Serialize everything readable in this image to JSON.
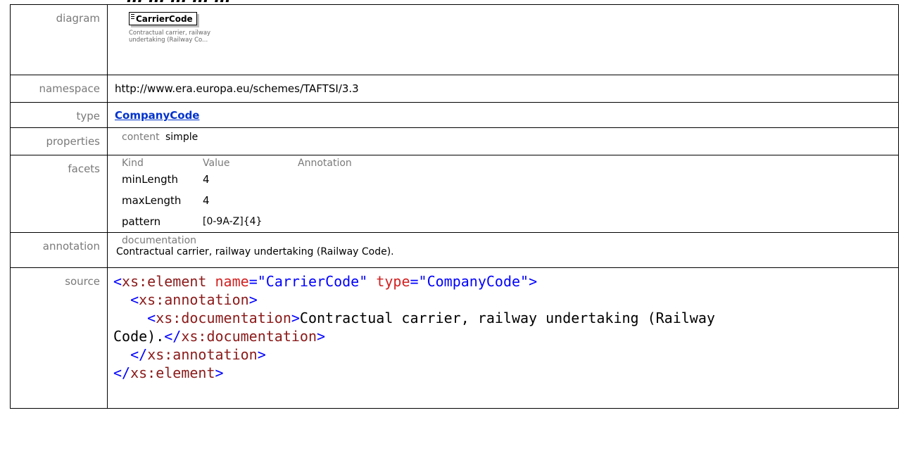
{
  "cut_title": "... ... ... ... ...",
  "rows": {
    "diagram": {
      "label": "diagram",
      "element_name": "CarrierCode",
      "element_desc": "Contractual carrier, railway undertaking (Railway Co..."
    },
    "namespace": {
      "label": "namespace",
      "value": "http://www.era.europa.eu/schemes/TAFTSI/3.3"
    },
    "type": {
      "label": "type",
      "value": "CompanyCode"
    },
    "properties": {
      "label": "properties",
      "key": "content",
      "value": "simple"
    },
    "facets": {
      "label": "facets",
      "headers": [
        "Kind",
        "Value",
        "Annotation"
      ],
      "items": [
        {
          "kind": "minLength",
          "value": "4"
        },
        {
          "kind": "maxLength",
          "value": "4"
        },
        {
          "kind": "pattern",
          "value": "[0-9A-Z]{4}"
        }
      ]
    },
    "annotation": {
      "label": "annotation",
      "heading": "documentation",
      "text": "Contractual carrier, railway undertaking (Railway Code)."
    },
    "source": {
      "label": "source",
      "element_open": "xs:element",
      "attr_name": "name",
      "attr_name_value": "\"CarrierCode\"",
      "attr_type": "type",
      "attr_type_value": "\"CompanyCode\"",
      "annotation_tag": "xs:annotation",
      "documentation_tag": "xs:documentation",
      "documentation_text_1": "Contractual carrier, railway undertaking (Railway",
      "documentation_text_2": "Code)."
    }
  }
}
